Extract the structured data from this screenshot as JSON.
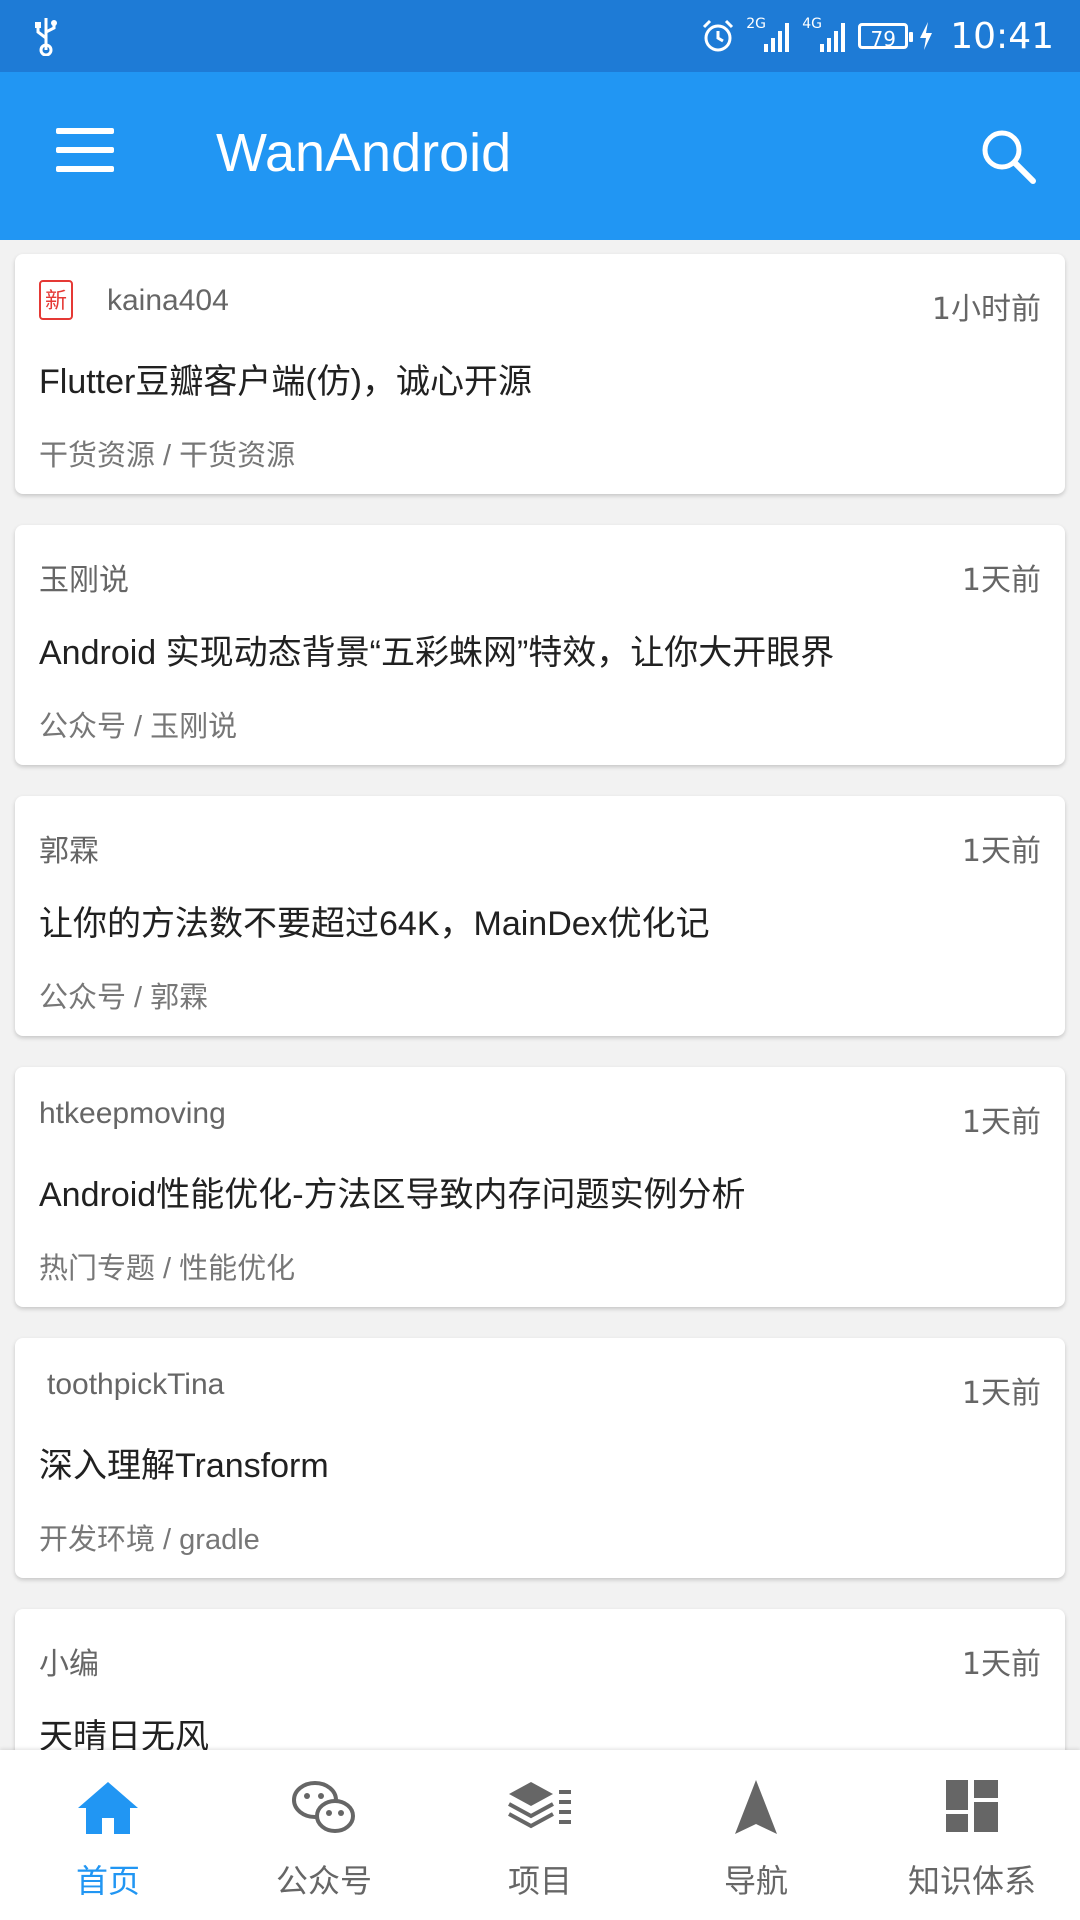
{
  "status_bar": {
    "signal_1": "2G",
    "signal_2": "4G",
    "battery": "79",
    "time": "10:41"
  },
  "app_bar": {
    "title": "WanAndroid",
    "menu_icon": "menu-icon",
    "search_icon": "search-icon"
  },
  "articles": [
    {
      "is_new": true,
      "new_label": "新",
      "author": "kaina404",
      "time": "1小时前",
      "title": "Flutter豆瓣客户端(仿)，诚心开源",
      "category": "干货资源 / 干货资源"
    },
    {
      "is_new": false,
      "author": "玉刚说",
      "time": "1天前",
      "title": "Android 实现动态背景“五彩蛛网”特效，让你大开眼界",
      "category": "公众号 / 玉刚说"
    },
    {
      "is_new": false,
      "author": "郭霖",
      "time": "1天前",
      "title": "让你的方法数不要超过64K，MainDex优化记",
      "category": "公众号 / 郭霖"
    },
    {
      "is_new": false,
      "author": "htkeepmoving",
      "time": "1天前",
      "title": "Android性能优化-方法区导致内存问题实例分析",
      "category": "热门专题 / 性能优化"
    },
    {
      "is_new": false,
      "author": "toothpickTina",
      "time": "1天前",
      "title": "深入理解Transform",
      "category": "开发环境 / gradle"
    },
    {
      "is_new": false,
      "author": "小编",
      "time": "1天前",
      "title": "天晴日无风",
      "category": ""
    }
  ],
  "bottom_nav": [
    {
      "label": "首页",
      "icon": "home-icon",
      "active": true
    },
    {
      "label": "公众号",
      "icon": "wechat-icon",
      "active": false
    },
    {
      "label": "项目",
      "icon": "layers-icon",
      "active": false
    },
    {
      "label": "导航",
      "icon": "navigation-arrow-icon",
      "active": false
    },
    {
      "label": "知识体系",
      "icon": "dashboard-icon",
      "active": false
    }
  ],
  "colors": {
    "status_bar": "#1e7bd6",
    "primary": "#2196f3",
    "new_badge": "#e53935",
    "inactive_nav": "#666666"
  }
}
